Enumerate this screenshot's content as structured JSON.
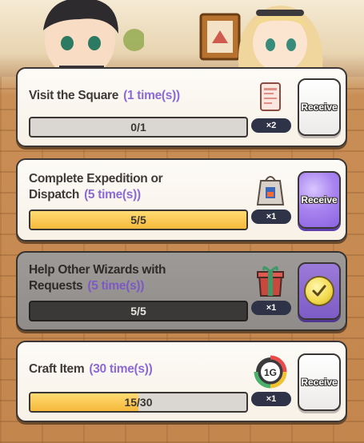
{
  "quests": [
    {
      "title": "Visit the Square",
      "count": "(1 time(s))",
      "progress_text": "0/1",
      "progress": 0,
      "reward_icon": "ticket-icon",
      "reward_qty": "×2",
      "button_label": "Receive",
      "state": "available"
    },
    {
      "title_line1": "Complete Expedition or",
      "title_line2": "Dispatch",
      "count": "(5 time(s))",
      "progress_text": "5/5",
      "progress": 1,
      "reward_icon": "gift-bag-icon",
      "reward_qty": "×1",
      "button_label": "Receive",
      "state": "claimable"
    },
    {
      "title_line1": "Help Other Wizards with",
      "title_line2": "Requests",
      "count": "(5 time(s))",
      "progress_text": "5/5",
      "progress": 1,
      "reward_icon": "gift-box-icon",
      "reward_qty": "×1",
      "state": "claimed"
    },
    {
      "title": "Craft Item",
      "count": "(30 time(s))",
      "progress_text": "15/30",
      "progress": 0.5,
      "reward_icon": "timer-badge-icon",
      "reward_badge_text": "1G",
      "reward_qty": "×1",
      "button_label": "Receive",
      "state": "available"
    }
  ],
  "colors": {
    "count_text": "#8c6ad6",
    "progress_fill": "#f6b93b",
    "qty_badge": "#2f3348",
    "card_border": "#3b3633"
  }
}
